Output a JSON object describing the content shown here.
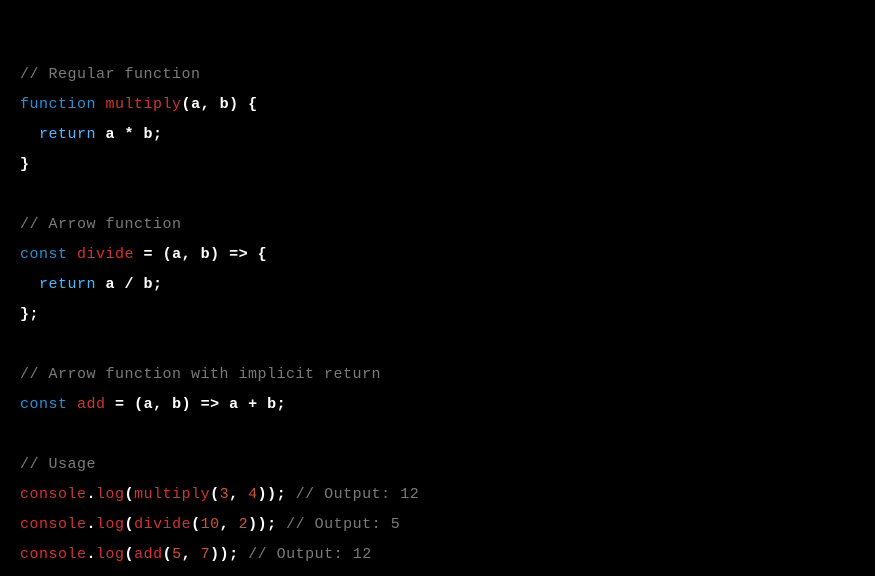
{
  "code": {
    "c1": "// Regular function",
    "l1_kw": "function",
    "l1_name": "multiply",
    "l1_paren_open": "(",
    "l1_params": "a, b",
    "l1_paren_close": ")",
    "l1_brace": " {",
    "l2_indent": "  ",
    "l2_return": "return",
    "l2_expr": " a * b;",
    "l3_close": "}",
    "c2": "// Arrow function",
    "l4_const": "const",
    "l4_sp1": " ",
    "l4_name": "divide",
    "l4_eq": " = ",
    "l4_paren_open": "(",
    "l4_params": "a, b",
    "l4_paren_close": ")",
    "l4_arrow": " => {",
    "l5_indent": "  ",
    "l5_return": "return",
    "l5_expr": " a / b;",
    "l6_close": "};",
    "c3": "// Arrow function with implicit return",
    "l7_const": "const",
    "l7_sp1": " ",
    "l7_name": "add",
    "l7_eq": " = ",
    "l7_paren_open": "(",
    "l7_params": "a, b",
    "l7_paren_close": ")",
    "l7_arrow": " => a + b;",
    "c4": "// Usage",
    "u1_obj": "console",
    "u1_dot": ".",
    "u1_method": "log",
    "u1_open": "(",
    "u1_fn": "multiply",
    "u1_popen": "(",
    "u1_a": "3",
    "u1_comma": ", ",
    "u1_b": "4",
    "u1_pclose": ")",
    "u1_close": ");",
    "u1_comment": " // Output: 12",
    "u2_obj": "console",
    "u2_dot": ".",
    "u2_method": "log",
    "u2_open": "(",
    "u2_fn": "divide",
    "u2_popen": "(",
    "u2_a": "10",
    "u2_comma": ", ",
    "u2_b": "2",
    "u2_pclose": ")",
    "u2_close": ");",
    "u2_comment": " // Output: 5",
    "u3_obj": "console",
    "u3_dot": ".",
    "u3_method": "log",
    "u3_open": "(",
    "u3_fn": "add",
    "u3_popen": "(",
    "u3_a": "5",
    "u3_comma": ", ",
    "u3_b": "7",
    "u3_pclose": ")",
    "u3_close": ");",
    "u3_comment": " // Output: 12"
  }
}
